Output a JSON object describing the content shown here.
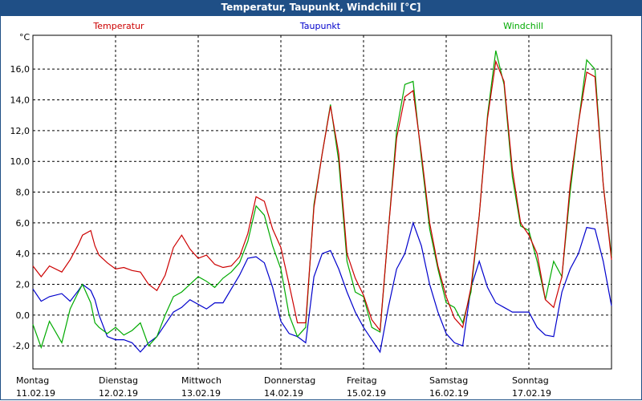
{
  "window": {
    "title": "Temperatur, Taupunkt, Windchill [°C]"
  },
  "colors": {
    "title_bg": "#1f4f86",
    "temperatur": "#cc0000",
    "taupunkt": "#0000cc",
    "windchill": "#00aa00"
  },
  "chart_data": {
    "type": "line",
    "title": "Temperatur, Taupunkt, Windchill [°C]",
    "ylabel": "°C",
    "ylim": [
      -3.5,
      18.2
    ],
    "yticks": [
      "-2,0",
      "0,0",
      "2,0",
      "4,0",
      "6,0",
      "8,0",
      "10,0",
      "12,0",
      "14,0",
      "16,0"
    ],
    "ytick_values": [
      -2,
      0,
      2,
      4,
      6,
      8,
      10,
      12,
      14,
      16
    ],
    "grid": true,
    "x_days": [
      {
        "day": "Montag",
        "date": "11.02.19"
      },
      {
        "day": "Dienstag",
        "date": "12.02.19"
      },
      {
        "day": "Mittwoch",
        "date": "13.02.19"
      },
      {
        "day": "Donnerstag",
        "date": "14.02.19"
      },
      {
        "day": "Freitag",
        "date": "15.02.19"
      },
      {
        "day": "Samstag",
        "date": "16.02.19"
      },
      {
        "day": "Sonntag",
        "date": "17.02.19"
      }
    ],
    "xlim": [
      0,
      7
    ],
    "series": [
      {
        "name": "Temperatur",
        "x": [
          0,
          0.1,
          0.2,
          0.35,
          0.45,
          0.55,
          0.6,
          0.7,
          0.75,
          0.8,
          0.9,
          1,
          1.1,
          1.2,
          1.3,
          1.4,
          1.5,
          1.6,
          1.7,
          1.8,
          1.9,
          2,
          2.1,
          2.2,
          2.3,
          2.4,
          2.5,
          2.6,
          2.7,
          2.8,
          2.9,
          3.0,
          3.1,
          3.2,
          3.3,
          3.4,
          3.5,
          3.6,
          3.7,
          3.8,
          3.9,
          4.0,
          4.1,
          4.2,
          4.3,
          4.4,
          4.5,
          4.6,
          4.7,
          4.8,
          4.9,
          5.0,
          5.1,
          5.2,
          5.3,
          5.4,
          5.5,
          5.6,
          5.7,
          5.8,
          5.9,
          6.0,
          6.1,
          6.2,
          6.3,
          6.4,
          6.5,
          6.6,
          6.7,
          6.8,
          6.9,
          7.0
        ],
        "y": [
          3.2,
          2.5,
          3.2,
          2.8,
          3.6,
          4.6,
          5.2,
          5.5,
          4.5,
          3.9,
          3.4,
          3.0,
          3.1,
          2.9,
          2.8,
          2.0,
          1.6,
          2.6,
          4.4,
          5.2,
          4.3,
          3.7,
          3.9,
          3.3,
          3.1,
          3.2,
          3.8,
          5.3,
          7.7,
          7.4,
          5.6,
          4.4,
          2.0,
          -0.5,
          -0.5,
          7.0,
          10.5,
          13.6,
          10.5,
          4.0,
          2.4,
          1.3,
          -0.3,
          -1.0,
          5.5,
          11.5,
          14.2,
          14.6,
          10.5,
          6.0,
          3.2,
          1.2,
          -0.2,
          -0.8,
          1.8,
          6.5,
          12.8,
          16.5,
          15.2,
          9.5,
          6.0,
          5.2,
          4.0,
          1.0,
          0.5,
          2.5,
          8.5,
          12.5,
          15.8,
          15.5,
          8.5,
          3.6
        ]
      },
      {
        "name": "Taupunkt",
        "x": [
          0,
          0.1,
          0.2,
          0.35,
          0.45,
          0.55,
          0.6,
          0.7,
          0.75,
          0.8,
          0.9,
          1,
          1.1,
          1.2,
          1.3,
          1.4,
          1.5,
          1.6,
          1.7,
          1.8,
          1.9,
          2,
          2.1,
          2.2,
          2.3,
          2.4,
          2.5,
          2.6,
          2.7,
          2.8,
          2.9,
          3.0,
          3.1,
          3.2,
          3.3,
          3.4,
          3.5,
          3.6,
          3.7,
          3.8,
          3.9,
          4.0,
          4.1,
          4.2,
          4.3,
          4.4,
          4.5,
          4.6,
          4.7,
          4.8,
          4.9,
          5.0,
          5.1,
          5.2,
          5.3,
          5.4,
          5.5,
          5.6,
          5.7,
          5.8,
          5.9,
          6.0,
          6.1,
          6.2,
          6.3,
          6.4,
          6.5,
          6.6,
          6.7,
          6.8,
          6.9,
          7.0
        ],
        "y": [
          1.7,
          0.9,
          1.2,
          1.4,
          0.9,
          1.6,
          2.0,
          1.6,
          1.0,
          0.0,
          -1.4,
          -1.6,
          -1.6,
          -1.8,
          -2.4,
          -1.8,
          -1.4,
          -0.6,
          0.2,
          0.5,
          1.0,
          0.7,
          0.4,
          0.8,
          0.8,
          1.7,
          2.6,
          3.7,
          3.8,
          3.4,
          1.8,
          -0.4,
          -1.2,
          -1.4,
          -1.8,
          2.5,
          4.0,
          4.2,
          3.0,
          1.5,
          0.2,
          -0.8,
          -1.6,
          -2.4,
          0.5,
          3.0,
          4.0,
          6.0,
          4.5,
          2.0,
          0.2,
          -1.2,
          -1.8,
          -2.0,
          1.8,
          3.5,
          1.8,
          0.8,
          0.5,
          0.2,
          0.2,
          0.2,
          -0.8,
          -1.3,
          -1.4,
          1.5,
          3.0,
          4.0,
          5.7,
          5.6,
          3.5,
          0.6
        ]
      },
      {
        "name": "Windchill",
        "x": [
          0,
          0.1,
          0.2,
          0.35,
          0.45,
          0.55,
          0.6,
          0.7,
          0.75,
          0.8,
          0.9,
          1,
          1.1,
          1.2,
          1.3,
          1.4,
          1.5,
          1.6,
          1.7,
          1.8,
          1.9,
          2,
          2.1,
          2.2,
          2.3,
          2.4,
          2.5,
          2.6,
          2.7,
          2.8,
          2.9,
          3.0,
          3.1,
          3.2,
          3.3,
          3.4,
          3.5,
          3.6,
          3.7,
          3.8,
          3.9,
          4.0,
          4.1,
          4.2,
          4.3,
          4.4,
          4.5,
          4.6,
          4.7,
          4.8,
          4.9,
          5.0,
          5.1,
          5.2,
          5.3,
          5.4,
          5.5,
          5.6,
          5.7,
          5.8,
          5.9,
          6.0,
          6.1,
          6.2,
          6.3,
          6.4,
          6.5,
          6.6,
          6.7,
          6.8,
          6.9,
          7.0
        ],
        "y": [
          -0.6,
          -2.1,
          -0.4,
          -1.8,
          0.4,
          1.5,
          2.0,
          0.8,
          -0.5,
          -0.8,
          -1.2,
          -0.8,
          -1.3,
          -1.0,
          -0.5,
          -2.0,
          -1.4,
          0.0,
          1.2,
          1.5,
          2.0,
          2.5,
          2.2,
          1.8,
          2.4,
          2.8,
          3.4,
          4.8,
          7.1,
          6.5,
          4.5,
          3.0,
          0.0,
          -1.4,
          -0.8,
          7.2,
          10.5,
          13.7,
          10.0,
          3.5,
          1.5,
          1.2,
          -0.8,
          -1.1,
          5.5,
          12.0,
          15.0,
          15.2,
          10.2,
          5.6,
          3.0,
          0.8,
          0.5,
          -0.5,
          1.5,
          6.5,
          13.0,
          17.2,
          15.0,
          9.0,
          5.8,
          5.5,
          3.5,
          1.0,
          3.5,
          2.5,
          8.0,
          12.5,
          16.6,
          16.0,
          8.5,
          3.8
        ]
      }
    ]
  }
}
